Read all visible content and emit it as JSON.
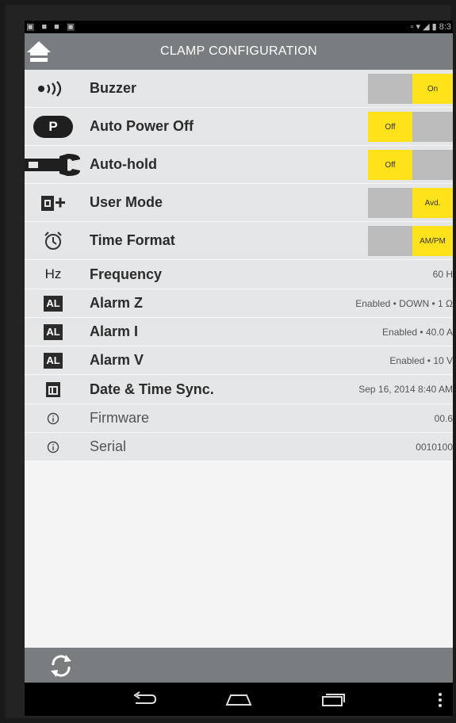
{
  "app": {
    "title": "CLAMP CONFIGURATION"
  },
  "status": {
    "left": "▣ ■ ■ ▣",
    "right": "▫ ▾ ◢ ▮ 8:3"
  },
  "rows": [
    {
      "label": "Buzzer",
      "icon": "sound-icon",
      "toggle": {
        "off": "",
        "on": "On",
        "state": "on"
      }
    },
    {
      "label": "Auto Power Off",
      "icon_text": "P",
      "toggle": {
        "off": "Off",
        "on": "",
        "state": "off"
      }
    },
    {
      "label": "Auto-hold",
      "icon": "clamp-meter-icon",
      "toggle": {
        "off": "Off",
        "on": "",
        "state": "off"
      }
    },
    {
      "label": "User Mode",
      "icon": "user-mode-icon",
      "toggle": {
        "off": "",
        "on": "Avd.",
        "state": "on"
      }
    },
    {
      "label": "Time Format",
      "icon": "alarm-clock-icon",
      "toggle": {
        "off": "",
        "on": "AM/PM",
        "state": "on"
      }
    },
    {
      "label": "Frequency",
      "icon_text": "Hz",
      "value": "60 H"
    },
    {
      "label": "Alarm Z",
      "icon_text": "AL",
      "value": "Enabled • DOWN • 1  Ω"
    },
    {
      "label": "Alarm I",
      "icon_text": "AL",
      "value": "Enabled • 40.0  A"
    },
    {
      "label": "Alarm V",
      "icon_text": "AL",
      "value": "Enabled • 10  V"
    },
    {
      "label": "Date & Time Sync.",
      "icon": "calendar-icon",
      "value": "Sep 16, 2014 8:40 AM"
    },
    {
      "label": "Firmware",
      "icon": "info-icon",
      "value": "00.6"
    },
    {
      "label": "Serial",
      "icon": "info-icon",
      "value": "0010100"
    }
  ],
  "colors": {
    "accent": "#ffe21a",
    "toolbar": "#7a7d7f",
    "row": "#e4e6e7",
    "toggle_off": "#bcbcbc"
  }
}
